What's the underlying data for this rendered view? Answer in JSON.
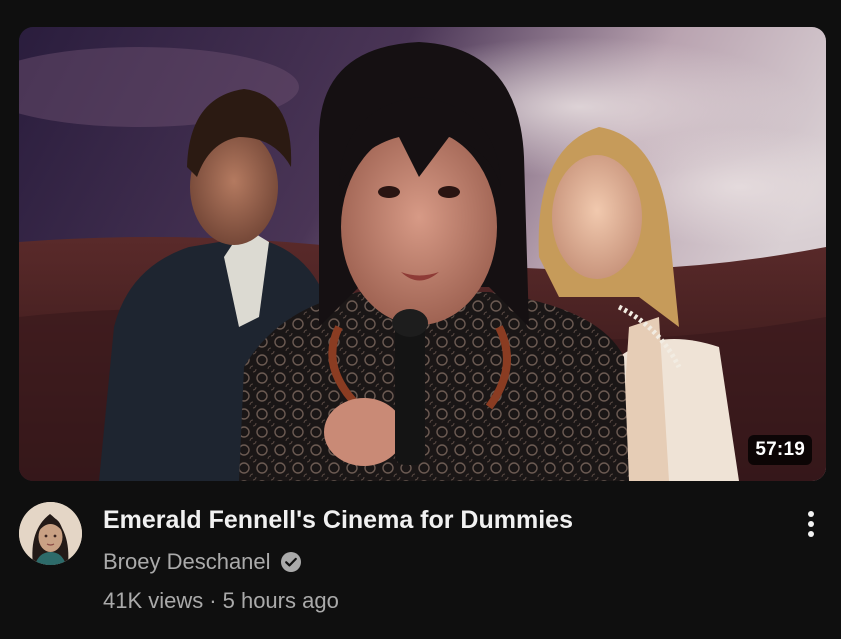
{
  "video": {
    "title": "Emerald Fennell's Cinema for Dummies",
    "duration": "57:19",
    "channel": "Broey Deschanel",
    "views": "41K views",
    "separator": "·",
    "age": "5 hours ago"
  },
  "icons": {
    "verified": "check-circle-icon",
    "menu": "more-vert-icon"
  },
  "colors": {
    "background": "#0f0f0f",
    "title": "#f1f1f1",
    "secondary_text": "#aaaaaa"
  }
}
